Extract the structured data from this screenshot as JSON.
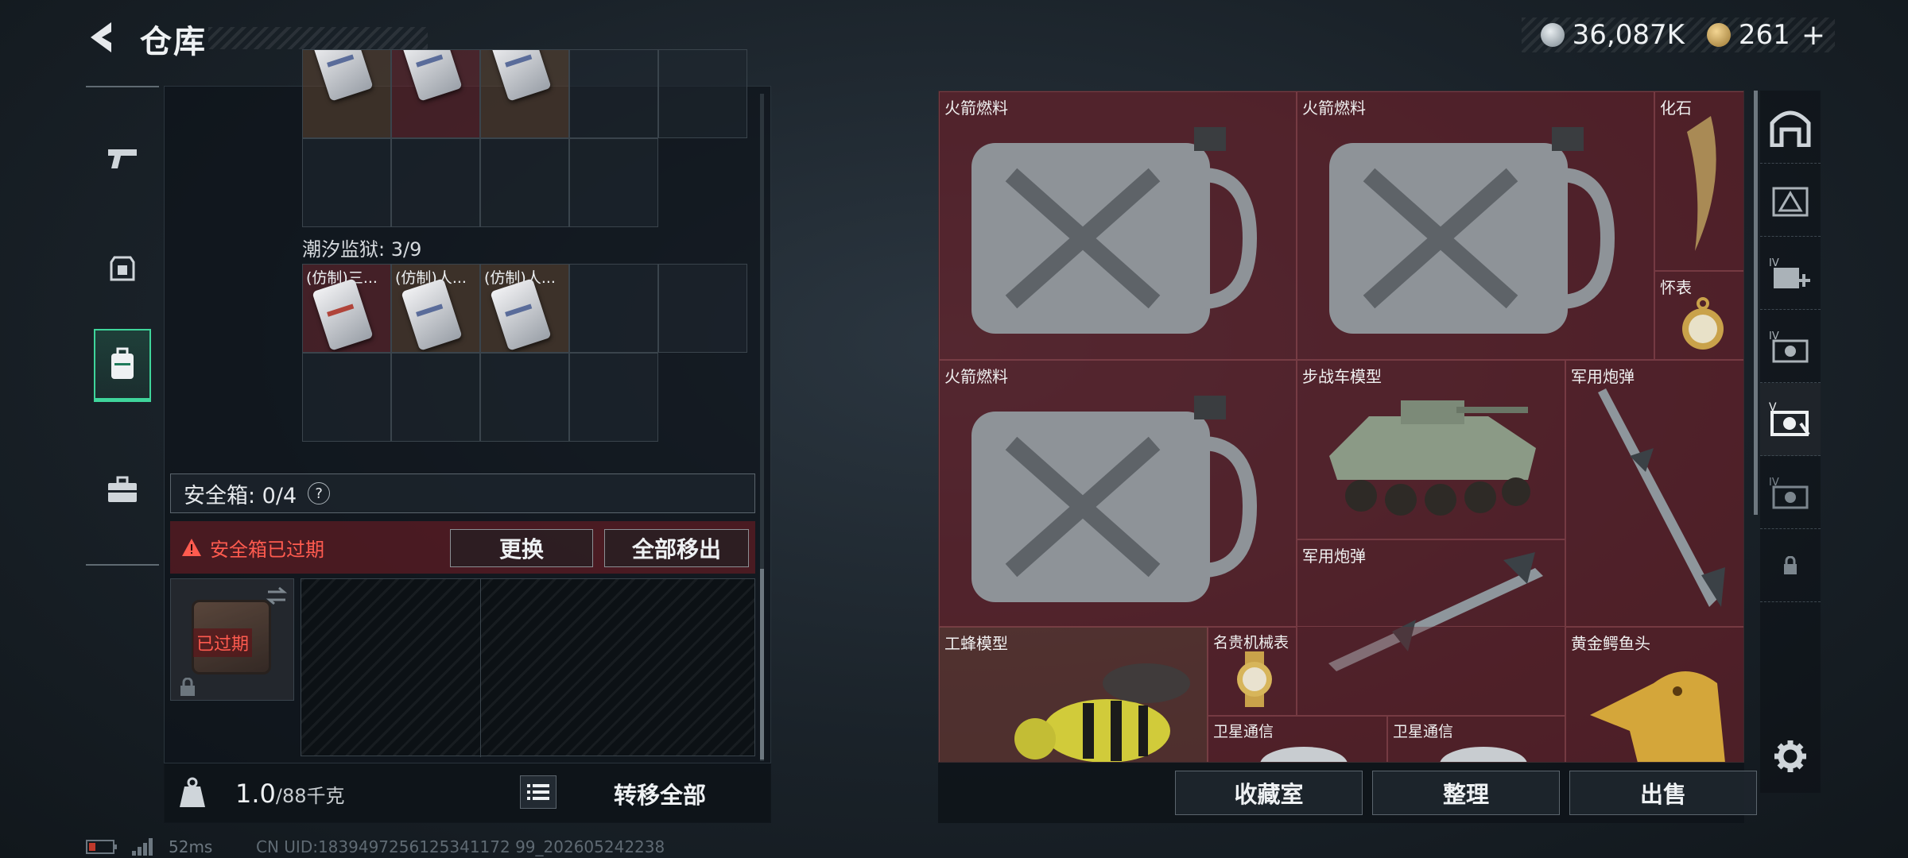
{
  "header": {
    "title": "仓库"
  },
  "currency": {
    "silver": "36,087K",
    "gold": "261",
    "plus": "+"
  },
  "left_panel": {
    "prison_label": "潮汐监狱: 3/9",
    "prison_items": [
      "(仿制)三...",
      "(仿制)人...",
      "(仿制)人..."
    ],
    "safebox_label": "安全箱: 0/4",
    "help": "?",
    "expired_notice": "安全箱已过期",
    "replace_button": "更换",
    "move_all_out_button": "全部移出",
    "case_status": "已过期",
    "weight_current": "1.0",
    "weight_max": "/88千克",
    "transfer_all_button": "转移全部"
  },
  "right_panel": {
    "items": {
      "fuel1": "火箭燃料",
      "fuel2": "火箭燃料",
      "fossil": "化石",
      "pocket_watch": "怀表",
      "fuel3": "火箭燃料",
      "ifv_model": "步战车模型",
      "shell1": "军用炮弹",
      "shell2": "军用炮弹",
      "bee_model": "工蜂模型",
      "luxury_watch": "名贵机械表",
      "gold_croc": "黄金鳄鱼头",
      "sat1": "卫星通信",
      "sat2": "卫星通信"
    },
    "collection_button": "收藏室",
    "organize_button": "整理",
    "sell_button": "出售"
  },
  "status": {
    "ping": "52ms",
    "uid": "CN UID:1839497256125341172 99_202605242238"
  },
  "colors": {
    "accent_green": "#3fd59b",
    "warning_red": "#ff5b4f",
    "item_red_bg": "#6e262e"
  }
}
